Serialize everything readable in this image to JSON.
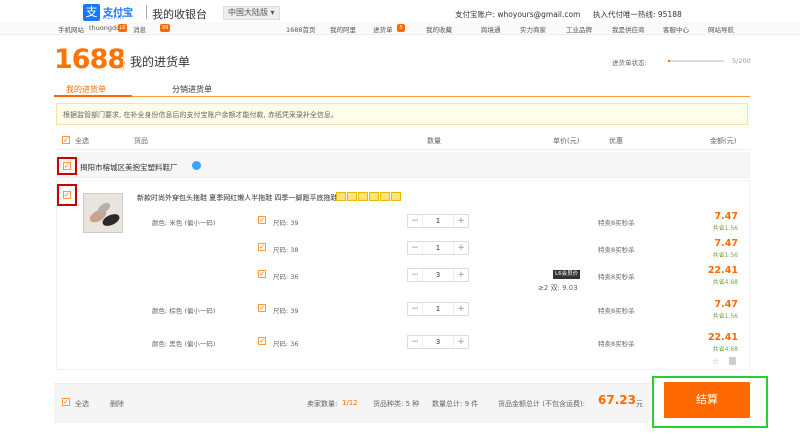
{
  "alipay": {
    "logo_icon": "支",
    "logo_text": "支付宝",
    "logo_sub": "ALIPAY",
    "cashier": "我的收银台",
    "region": "中国大陆版 ▾",
    "account": "支付宝账户: whoyours@gmail.com",
    "proxy": "执入代付",
    "hotline": "唯一热线: 95188"
  },
  "nav": {
    "mobile": "手机网站",
    "user": "thuongdo8",
    "vip": "L6",
    "messages": "消息",
    "messages_count": "99",
    "items": [
      "1688首页",
      "我的阿里",
      "进货单",
      "我的收藏",
      "跨境通",
      "实力商家",
      "工业品牌",
      "我是供应商",
      "客服中心",
      "网站导航"
    ],
    "cart_count": "5"
  },
  "header": {
    "logo": "1688",
    "title": "我的进货单",
    "capacity_label": "进货单状态:",
    "capacity_value": "5/200",
    "capacity_fraction": 0.025
  },
  "tabs": [
    "我的进货单",
    "分销进货单"
  ],
  "notice": "根据监管部门要求, 在补全身份信息后的支付宝账户余额才能付款, 赤纸凭采录补全信息。",
  "columns": {
    "select_all": "全选",
    "product": "货品",
    "quantity": "数量",
    "unit_price": "单价(元)",
    "discount": "优惠",
    "amount": "金额(元)"
  },
  "shop": {
    "name": "揭阳市榕城区美抱宝塑料鞋厂"
  },
  "product": {
    "title": "新款时尚外穿包头拖鞋 夏季网红懒人半拖鞋 四季一脚蹬平底拖鞋女",
    "variants": [
      {
        "color": "颜色: 米色 (偏小一码)",
        "size": "尺码: 39",
        "qty": "1",
        "promo": "特卖8买秒杀",
        "amount": "7.47",
        "saved": "共省1.56"
      },
      {
        "color": "",
        "size": "尺码: 38",
        "qty": "1",
        "promo": "特卖8买秒杀",
        "amount": "7.47",
        "saved": "共省1.56"
      },
      {
        "color": "",
        "size": "尺码: 36",
        "qty": "3",
        "promo": "特卖8买秒杀",
        "amount": "22.41",
        "saved": "共省4.68"
      },
      {
        "color": "颜色: 棕色 (偏小一码)",
        "size": "尺码: 39",
        "qty": "1",
        "promo": "特卖8买秒杀",
        "amount": "7.47",
        "saved": "共省1.56"
      },
      {
        "color": "颜色: 黑色 (偏小一码)",
        "size": "尺码: 36",
        "qty": "3",
        "promo": "特卖8买秒杀",
        "amount": "22.41",
        "saved": "共省4.68"
      }
    ],
    "member_badge": "L6会员价",
    "tier_price": "≥2 双: 9.03"
  },
  "footer": {
    "select_all": "全选",
    "delete": "删除",
    "sellers_label": "卖家数量:",
    "sellers_value": "1/12",
    "kinds_label": "货品种类: 5 种",
    "qty_label": "数量总计: 9 件",
    "total_label": "货品金额总计 (不包含运费):",
    "total_value": "67.23",
    "currency": "元",
    "checkout": "结算"
  },
  "colors": {
    "accent": "#ff6a00",
    "alipay_blue": "#1677ff",
    "highlight_red": "#cc0000",
    "highlight_green": "#25d030"
  }
}
